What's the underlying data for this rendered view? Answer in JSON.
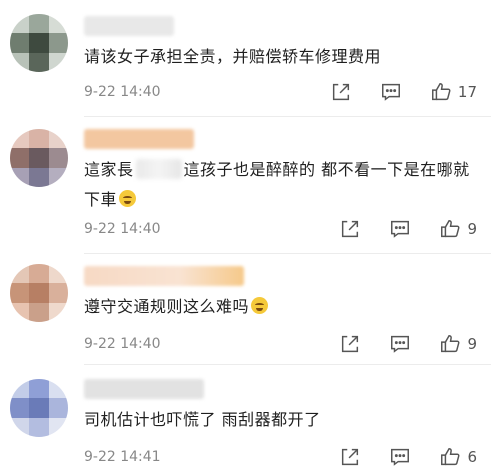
{
  "comments": [
    {
      "text": "请该女子承担全责，并赔偿轿车修理费用",
      "text_after": "",
      "censored": false,
      "emoji": false,
      "time": "9-22 14:40",
      "likes": "17",
      "avatar_colors": [
        "#c9d1c9",
        "#9aa79b",
        "#d6dcd5",
        "#6f7d6f",
        "#3e4a3f",
        "#8c988c",
        "#b8c2b8",
        "#5a665a",
        "#cfd6cf"
      ],
      "name_color": "#e8e8e8"
    },
    {
      "text": "這家長",
      "text_after": "這孩子也是醉醉的 都不看一下是在哪就下車",
      "censored": true,
      "emoji": true,
      "time": "9-22 14:40",
      "likes": "9",
      "avatar_colors": [
        "#e6c9bf",
        "#d9b3a6",
        "#e8d2ca",
        "#8f6f69",
        "#6a5a5f",
        "#9c8b90",
        "#a7a0b5",
        "#7b7893",
        "#b4aebf"
      ],
      "name_color": "#f3c7a0"
    },
    {
      "text": "遵守交通规则这么难吗",
      "text_after": "",
      "censored": false,
      "emoji": true,
      "time": "9-22 14:40",
      "likes": "9",
      "avatar_colors": [
        "#e4c7b6",
        "#d7ab95",
        "#eed8cb",
        "#c79478",
        "#b77f64",
        "#d9b09b",
        "#e7c3b0",
        "#caa08a",
        "#efd9cc"
      ],
      "name_color": "#f6d0b0"
    },
    {
      "text": "司机估计也吓慌了 雨刮器都开了",
      "text_after": "",
      "censored": false,
      "emoji": false,
      "time": "9-22 14:41",
      "likes": "6",
      "avatar_colors": [
        "#c3cde8",
        "#8f9fd6",
        "#d9dff0",
        "#7f8fc8",
        "#6a7bb8",
        "#aab5dc",
        "#d0d6ea",
        "#b3bde0",
        "#e1e5f2"
      ],
      "name_color": "#e2e2e2"
    }
  ]
}
